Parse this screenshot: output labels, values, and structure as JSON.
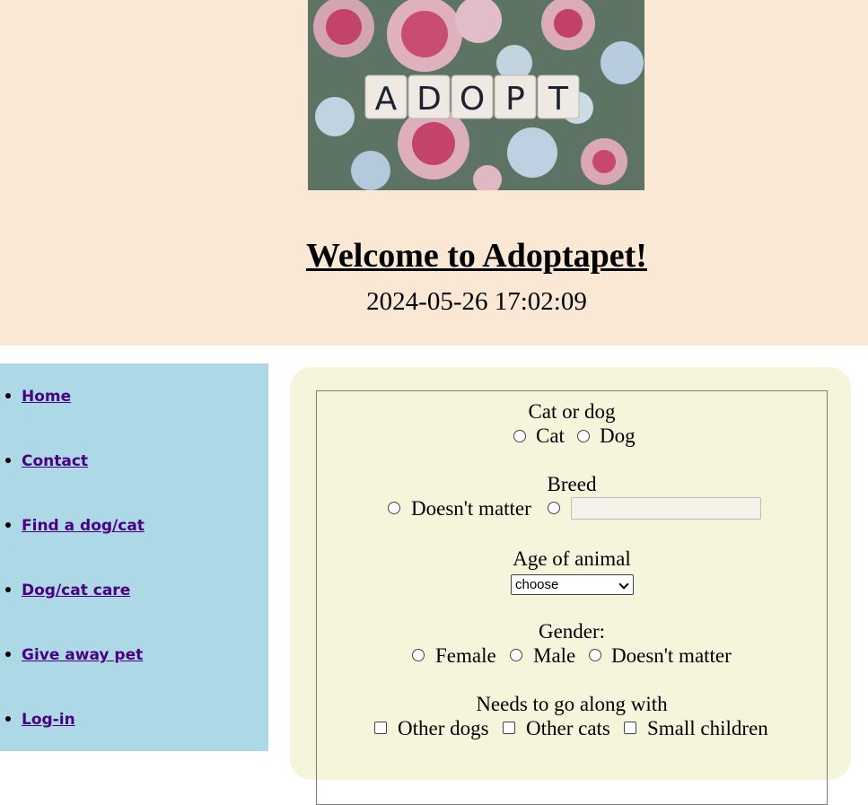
{
  "header": {
    "banner_letters": [
      "A",
      "D",
      "O",
      "P",
      "T"
    ],
    "title": "Welcome to Adoptapet!",
    "datetime": "2024-05-26 17:02:09"
  },
  "sidebar": {
    "items": [
      {
        "label": "Home"
      },
      {
        "label": "Contact"
      },
      {
        "label": "Find a dog/cat"
      },
      {
        "label": "Dog/cat care"
      },
      {
        "label": "Give away pet"
      },
      {
        "label": "Log-in"
      }
    ]
  },
  "form": {
    "pet_type": {
      "label": "Cat or dog",
      "options": [
        "Cat",
        "Dog"
      ]
    },
    "breed": {
      "label": "Breed",
      "option_any": "Doesn't matter",
      "input_value": ""
    },
    "age": {
      "label": "Age of animal",
      "selected": "choose"
    },
    "gender": {
      "label": "Gender:",
      "options": [
        "Female",
        "Male",
        "Doesn't matter"
      ]
    },
    "compat": {
      "label": "Needs to go along with",
      "options": [
        "Other dogs",
        "Other cats",
        "Small children"
      ]
    }
  },
  "colors": {
    "header_bg": "#fae8d5",
    "sidebar_bg": "#add8e6",
    "panel_bg": "#f5f5dc",
    "link": "#4b0082"
  }
}
